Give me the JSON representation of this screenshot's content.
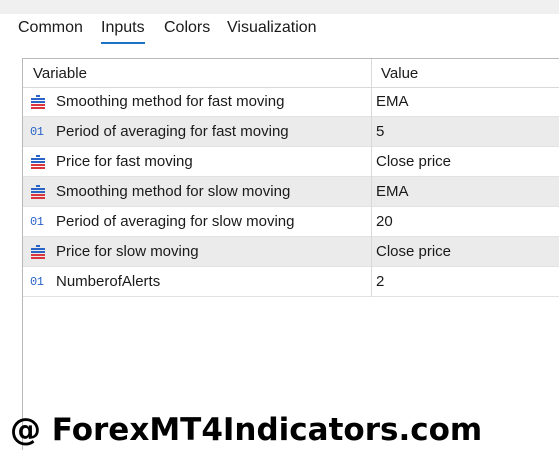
{
  "tabs": [
    {
      "label": "Common",
      "active": false
    },
    {
      "label": "Inputs",
      "active": true
    },
    {
      "label": "Colors",
      "active": false
    },
    {
      "label": "Visualization",
      "active": false
    }
  ],
  "table": {
    "headers": {
      "variable": "Variable",
      "value": "Value"
    },
    "rows": [
      {
        "icon": "enum-list-icon",
        "variable": "Smoothing method for fast moving",
        "value": "EMA"
      },
      {
        "icon": "integer-01-icon",
        "variable": "Period of averaging for fast moving",
        "value": "5"
      },
      {
        "icon": "enum-list-icon",
        "variable": "Price for fast moving",
        "value": "Close price"
      },
      {
        "icon": "enum-list-icon",
        "variable": "Smoothing method for slow moving",
        "value": "EMA"
      },
      {
        "icon": "integer-01-icon",
        "variable": "Period of averaging for slow moving",
        "value": "20"
      },
      {
        "icon": "enum-list-icon",
        "variable": "Price for slow moving",
        "value": "Close price"
      },
      {
        "icon": "integer-01-icon",
        "variable": "NumberofAlerts",
        "value": "2"
      }
    ]
  },
  "icon_text": {
    "integer": "01"
  },
  "colors": {
    "tab_underline": "#1a73c9",
    "alt_row": "#ebebeb",
    "enum_icon_blue": "#2a64c6",
    "enum_icon_red": "#d9363e"
  },
  "watermark": "@ ForexMT4Indicators.com"
}
